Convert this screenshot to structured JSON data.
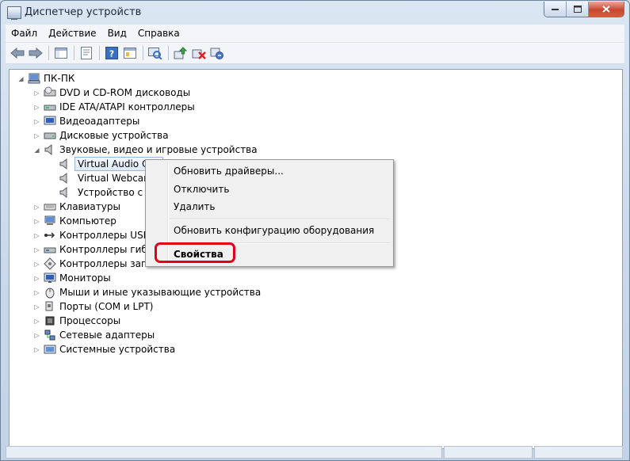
{
  "window": {
    "title": "Диспетчер устройств",
    "caption_buttons": [
      "minimize",
      "maximize",
      "close"
    ]
  },
  "menubar": {
    "items": [
      "Файл",
      "Действие",
      "Вид",
      "Справка"
    ]
  },
  "toolbar": {
    "icons": [
      "back-arrow-icon",
      "forward-arrow-icon",
      "console-tree-icon",
      "properties-icon",
      "help-icon",
      "view-icon",
      "scan-hardware-icon",
      "update-driver-icon",
      "uninstall-icon",
      "disable-icon"
    ]
  },
  "tree": {
    "root": "ПК-ПК",
    "nodes": [
      {
        "label": "DVD и CD-ROM дисководы",
        "icon": "dvd-drive-icon"
      },
      {
        "label": "IDE ATA/ATAPI контроллеры",
        "icon": "ide-controller-icon"
      },
      {
        "label": "Видеоадаптеры",
        "icon": "display-adapter-icon"
      },
      {
        "label": "Дисковые устройства",
        "icon": "disk-drive-icon"
      },
      {
        "label": "Звуковые, видео и игровые устройства",
        "icon": "speaker-icon",
        "expanded": true,
        "children": [
          {
            "label": "Virtual Audio Cab",
            "icon": "speaker-icon",
            "selected": true
          },
          {
            "label": "Virtual Webcam a",
            "icon": "speaker-icon"
          },
          {
            "label": "Устройство с по",
            "icon": "speaker-icon"
          }
        ]
      },
      {
        "label": "Клавиатуры",
        "icon": "keyboard-icon"
      },
      {
        "label": "Компьютер",
        "icon": "computer-icon"
      },
      {
        "label": "Контроллеры USB",
        "icon": "usb-icon"
      },
      {
        "label": "Контроллеры гибки",
        "icon": "floppy-controller-icon"
      },
      {
        "label": "Контроллеры запоми",
        "icon": "storage-controller-icon"
      },
      {
        "label": "Мониторы",
        "icon": "monitor-icon"
      },
      {
        "label": "Мыши и иные указывающие устройства",
        "icon": "mouse-icon"
      },
      {
        "label": "Порты (COM и LPT)",
        "icon": "port-icon"
      },
      {
        "label": "Процессоры",
        "icon": "processor-icon"
      },
      {
        "label": "Сетевые адаптеры",
        "icon": "network-adapter-icon"
      },
      {
        "label": "Системные устройства",
        "icon": "system-device-icon"
      }
    ]
  },
  "context_menu": {
    "items": [
      "Обновить драйверы...",
      "Отключить",
      "Удалить",
      "Обновить конфигурацию оборудования",
      "Свойства"
    ],
    "highlighted": "Свойства"
  },
  "colors": {
    "highlight": "#e0001a",
    "window_frame": "#c9d8ea",
    "selection": "#dce8f7"
  }
}
